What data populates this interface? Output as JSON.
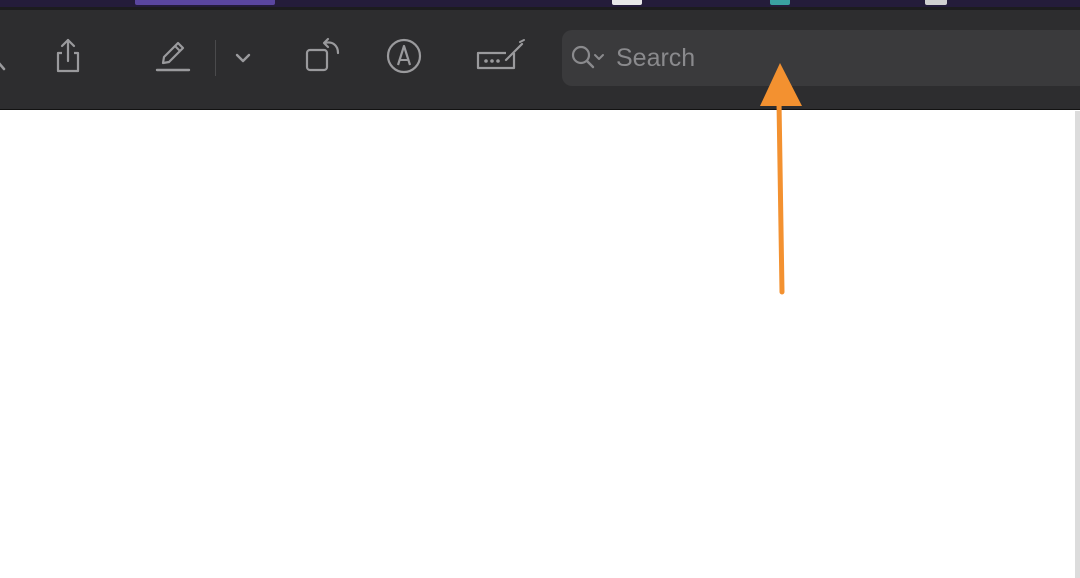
{
  "toolbar": {
    "buttons": [
      {
        "name": "share",
        "icon": "share-icon"
      },
      {
        "name": "markup",
        "icon": "highlight-pen-icon"
      },
      {
        "name": "markup-menu",
        "icon": "chevron-down-icon"
      },
      {
        "name": "rotate",
        "icon": "rotate-icon"
      },
      {
        "name": "annotate",
        "icon": "pen-tip-circle-icon"
      },
      {
        "name": "form-fill",
        "icon": "form-field-icon"
      }
    ],
    "icon_color": "#9a9a9d",
    "background": "#2d2d2f"
  },
  "search": {
    "placeholder": "Search",
    "value": "",
    "icon": "search-menu-icon"
  },
  "annotation": {
    "type": "arrow",
    "color": "#f39130",
    "points_to": "search-input"
  },
  "document": {
    "background": "#ffffff"
  }
}
